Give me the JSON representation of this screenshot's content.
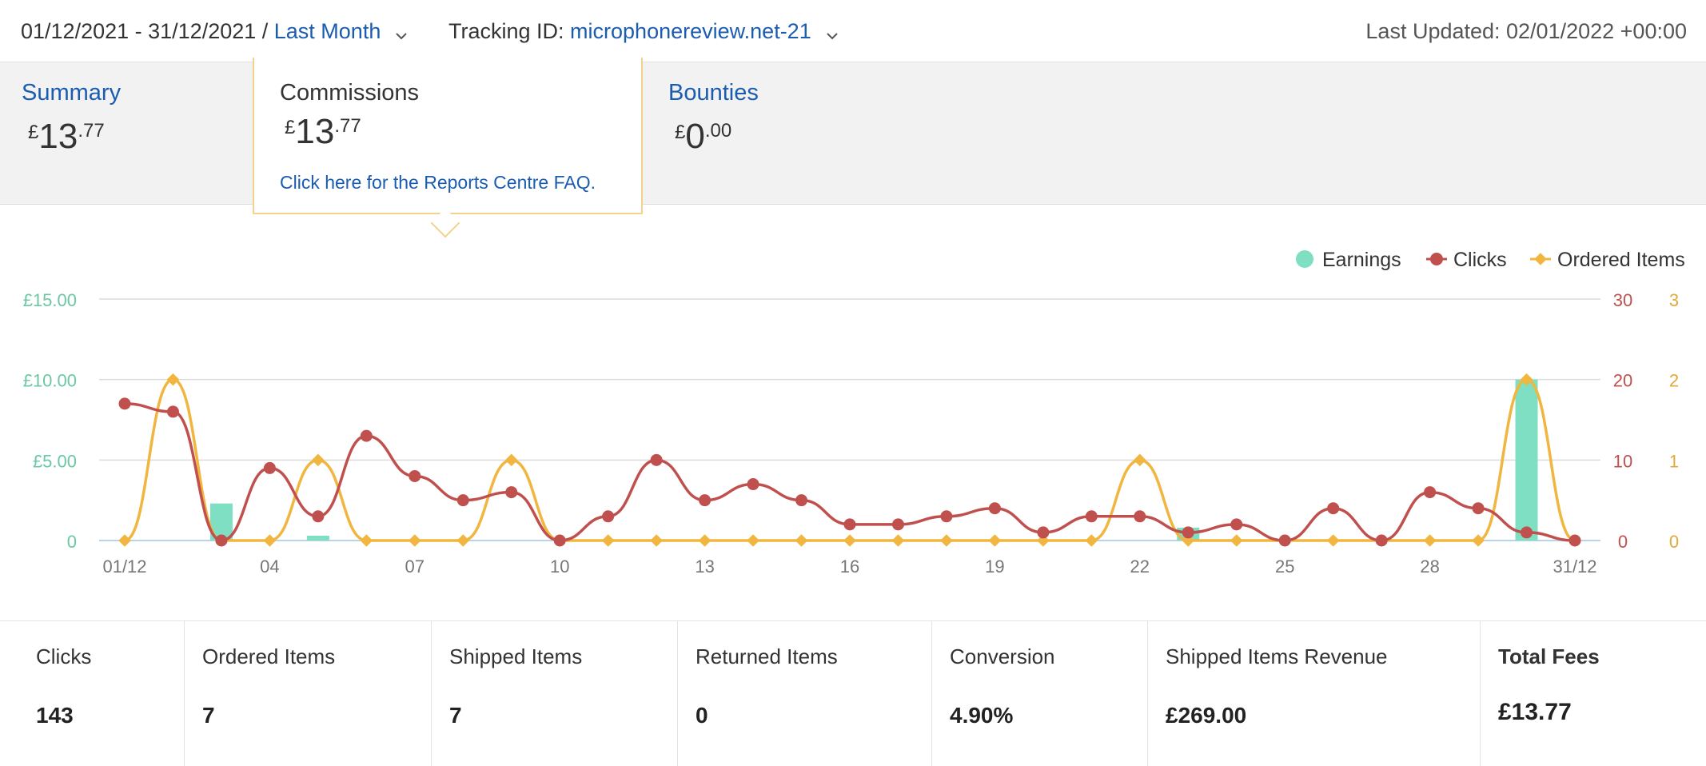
{
  "header": {
    "date_range": "01/12/2021 - 31/12/2021 / ",
    "period_label": "Last Month",
    "tracking_prefix": "Tracking ID: ",
    "tracking_id": "microphonereview.net-21",
    "last_updated": "Last Updated: 02/01/2022 +00:00"
  },
  "tabs": [
    {
      "label": "Summary",
      "currency": "£",
      "int": "13",
      "dec": ".77"
    },
    {
      "label": "Commissions",
      "currency": "£",
      "int": "13",
      "dec": ".77"
    },
    {
      "label": "Bounties",
      "currency": "£",
      "int": "0",
      "dec": ".00"
    }
  ],
  "popup": {
    "title": "Commissions",
    "currency": "£",
    "int": "13",
    "dec": ".77",
    "link": "Click here for the Reports Centre FAQ."
  },
  "colors": {
    "earnings": "#7fdfc2",
    "clicks": "#c0504d",
    "ordered": "#f0b63f",
    "earnings_axis": "#6cc8a4",
    "clicks_axis": "#c0504d",
    "ordered_axis": "#e0a93a",
    "grid": "#dcdcdc",
    "link": "#1a5cb0"
  },
  "chart_data": {
    "type": "line",
    "x": [
      "01/12",
      "02/12",
      "03/12",
      "04/12",
      "05/12",
      "06/12",
      "07/12",
      "08/12",
      "09/12",
      "10/12",
      "11/12",
      "12/12",
      "13/12",
      "14/12",
      "15/12",
      "16/12",
      "17/12",
      "18/12",
      "19/12",
      "20/12",
      "21/12",
      "22/12",
      "23/12",
      "24/12",
      "25/12",
      "26/12",
      "27/12",
      "28/12",
      "29/12",
      "30/12",
      "31/12"
    ],
    "x_tick_labels": [
      "01/12",
      "",
      "",
      "04",
      "",
      "",
      "07",
      "",
      "",
      "10",
      "",
      "",
      "13",
      "",
      "",
      "16",
      "",
      "",
      "19",
      "",
      "",
      "22",
      "",
      "",
      "25",
      "",
      "",
      "28",
      "",
      "",
      "31/12"
    ],
    "series": [
      {
        "name": "Earnings",
        "chart": "bar",
        "axis": "left",
        "values": [
          0,
          0,
          2.3,
          0,
          0.3,
          0,
          0,
          0,
          0,
          0,
          0,
          0,
          0,
          0,
          0,
          0,
          0,
          0,
          0,
          0,
          0,
          0,
          0.8,
          0,
          0,
          0,
          0,
          0,
          0,
          10,
          0
        ]
      },
      {
        "name": "Clicks",
        "chart": "line",
        "axis": "right1",
        "values": [
          17,
          16,
          0,
          9,
          3,
          13,
          8,
          5,
          6,
          0,
          3,
          10,
          5,
          7,
          5,
          2,
          2,
          3,
          4,
          1,
          3,
          3,
          1,
          2,
          0,
          4,
          0,
          6,
          4,
          1,
          0
        ]
      },
      {
        "name": "Ordered Items",
        "chart": "line",
        "axis": "right2",
        "values": [
          0,
          2,
          0,
          0,
          1,
          0,
          0,
          0,
          1,
          0,
          0,
          0,
          0,
          0,
          0,
          0,
          0,
          0,
          0,
          0,
          0,
          1,
          0,
          0,
          0,
          0,
          0,
          0,
          0,
          2,
          0
        ]
      }
    ],
    "axes": {
      "left": {
        "ticks": [
          "0",
          "£5.00",
          "£10.00",
          "£15.00"
        ],
        "values": [
          0,
          5,
          10,
          15
        ],
        "range": [
          0,
          15
        ]
      },
      "right1": {
        "ticks": [
          "0",
          "10",
          "20",
          "30"
        ],
        "values": [
          0,
          10,
          20,
          30
        ],
        "range": [
          0,
          30
        ]
      },
      "right2": {
        "ticks": [
          "0",
          "1",
          "2",
          "3"
        ],
        "values": [
          0,
          1,
          2,
          3
        ],
        "range": [
          0,
          3
        ]
      }
    },
    "grid": true,
    "legend": "top-right"
  },
  "stats": [
    {
      "label": "Clicks",
      "value": "143"
    },
    {
      "label": "Ordered Items",
      "value": "7"
    },
    {
      "label": "Shipped Items",
      "value": "7"
    },
    {
      "label": "Returned Items",
      "value": "0"
    },
    {
      "label": "Conversion",
      "value": "4.90%"
    },
    {
      "label": "Shipped Items Revenue",
      "value": "£269.00"
    },
    {
      "label": "Total Fees",
      "value": "£13.77",
      "bold_label": true
    }
  ]
}
